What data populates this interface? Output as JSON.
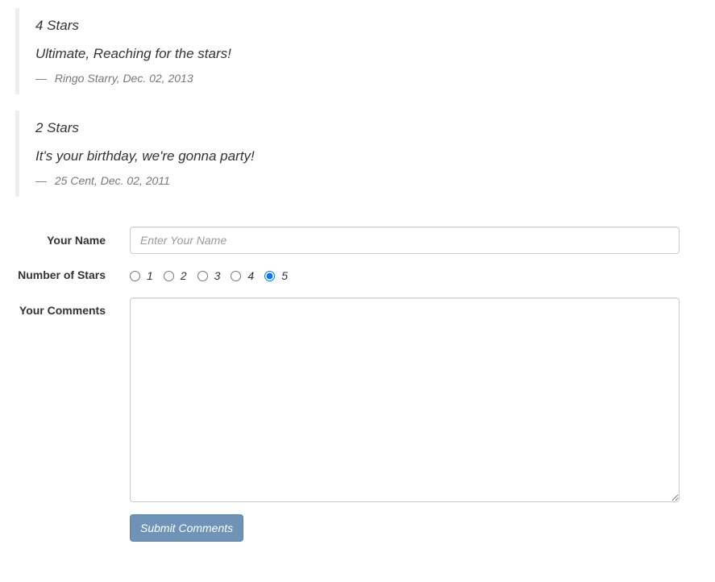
{
  "reviews": [
    {
      "stars": "4 Stars",
      "body": "Ultimate, Reaching for the stars!",
      "dash": "—",
      "author": "Ringo Starry, Dec. 02, 2013"
    },
    {
      "stars": "2 Stars",
      "body": "It's your birthday, we're gonna party!",
      "dash": "—",
      "author": "25 Cent, Dec. 02, 2011"
    }
  ],
  "form": {
    "name_label": "Your Name",
    "name_placeholder": "Enter Your Name",
    "name_value": "",
    "stars_label": "Number of Stars",
    "star_options": [
      "1",
      "2",
      "3",
      "4",
      "5"
    ],
    "selected_stars": "5",
    "comments_label": "Your Comments",
    "comments_value": "",
    "submit_label": "Submit Comments"
  },
  "colors": {
    "submit_bg": "#6f93b6",
    "review_border": "#eeeeee"
  }
}
